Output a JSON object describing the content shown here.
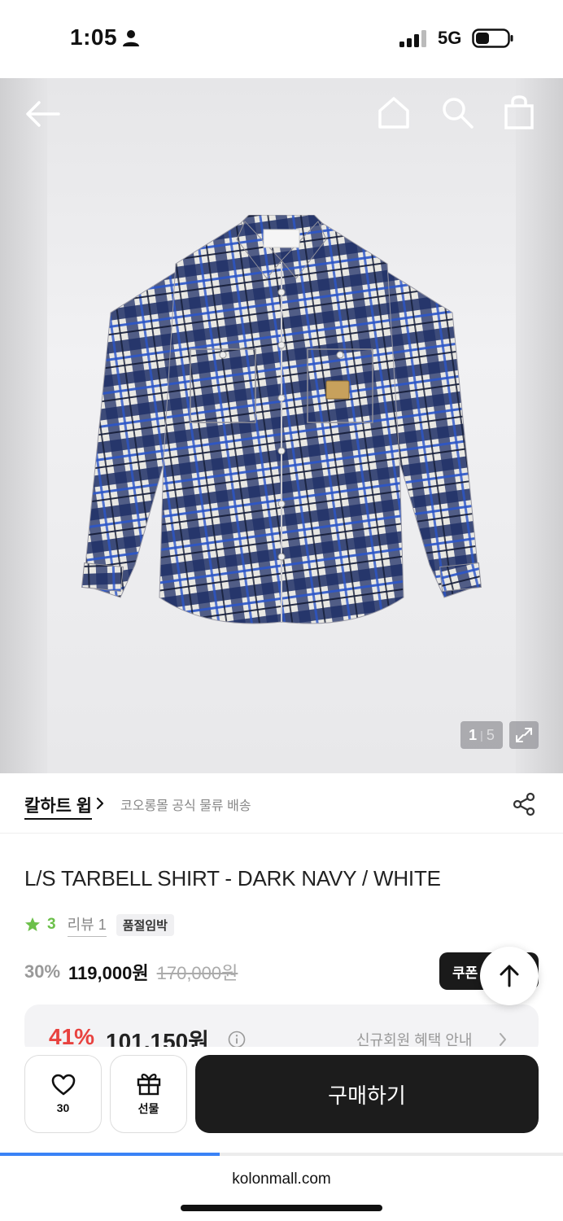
{
  "status_bar": {
    "time": "1:05",
    "network": "5G"
  },
  "hero": {
    "image_index": "1",
    "image_total": "5",
    "image_alt": "plaid long sleeve shirt"
  },
  "brand": {
    "name": "칼하트 윕",
    "note": "코오롱몰 공식 물류 배송"
  },
  "product": {
    "title": "L/S TARBELL SHIRT - DARK NAVY / WHITE",
    "rating": "3",
    "review_label": "리뷰 1",
    "stock_badge": "품절임박",
    "discount_rate": "30%",
    "price": "119,000원",
    "original_price": "170,000원",
    "coupon_label": "쿠폰"
  },
  "member_offer": {
    "discount_rate": "41%",
    "price": "101,150원",
    "link_label": "신규회원 혜택 안내"
  },
  "actions": {
    "like_count": "30",
    "gift_label": "선물",
    "buy_label": "구매하기"
  },
  "browser": {
    "url": "kolonmall.com",
    "load_progress": 0.39
  },
  "colors": {
    "accent_green": "#6cc04a",
    "member_red": "#e8423f",
    "primary_dark": "#1c1c1c",
    "progress_blue": "#3a82f6"
  },
  "icons": [
    "person-icon",
    "signal-icon",
    "battery-icon",
    "back-arrow-icon",
    "home-icon",
    "search-icon",
    "shopping-bag-icon",
    "expand-icon",
    "chevron-right-icon",
    "share-icon",
    "star-icon",
    "arrow-up-icon",
    "info-icon",
    "heart-icon",
    "gift-icon"
  ]
}
